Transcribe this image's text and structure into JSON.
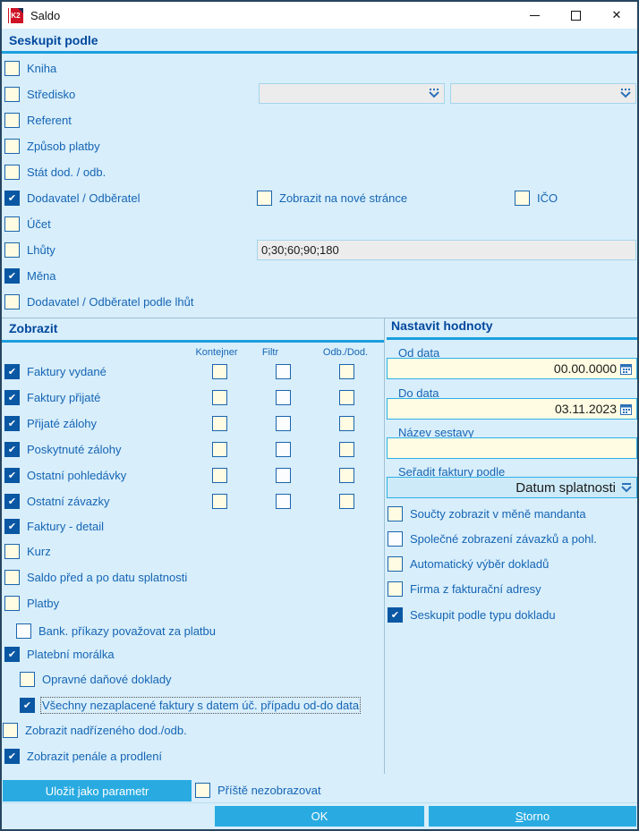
{
  "window": {
    "title": "Saldo"
  },
  "group_by": {
    "title": "Seskupit podle",
    "items": [
      {
        "label": "Kniha",
        "checked": false
      },
      {
        "label": "Středisko",
        "checked": false
      },
      {
        "label": "Referent",
        "checked": false
      },
      {
        "label": "Způsob platby",
        "checked": false
      },
      {
        "label": "Stát dod. / odb.",
        "checked": false
      },
      {
        "label": "Dodavatel / Odběratel",
        "checked": true
      },
      {
        "label": "Účet",
        "checked": false
      },
      {
        "label": "Lhůty",
        "checked": false
      },
      {
        "label": "Měna",
        "checked": true
      },
      {
        "label": "Dodavatel / Odběratel podle lhůt",
        "checked": false
      }
    ],
    "new_page": {
      "label": "Zobrazit na nové stránce",
      "checked": false
    },
    "ico": {
      "label": "IČO",
      "checked": false
    },
    "lhuty_value": "0;30;60;90;180",
    "combo1_value": "",
    "combo2_value": ""
  },
  "show": {
    "title": "Zobrazit",
    "columns": [
      "Kontejner",
      "Filtr",
      "Odb./Dod."
    ],
    "rows": [
      {
        "label": "Faktury vydané",
        "checked": true,
        "kontejner": false,
        "filtr": false,
        "odb_dod": false
      },
      {
        "label": "Faktury přijaté",
        "checked": true,
        "kontejner": false,
        "filtr": false,
        "odb_dod": false
      },
      {
        "label": "Přijaté zálohy",
        "checked": true,
        "kontejner": false,
        "filtr": false,
        "odb_dod": false
      },
      {
        "label": "Poskytnuté zálohy",
        "checked": true,
        "kontejner": false,
        "filtr": false,
        "odb_dod": false
      },
      {
        "label": "Ostatní pohledávky",
        "checked": true,
        "kontejner": false,
        "filtr": false,
        "odb_dod": false
      },
      {
        "label": "Ostatní závazky",
        "checked": true,
        "kontejner": false,
        "filtr": false,
        "odb_dod": false
      }
    ],
    "extra_rows": [
      {
        "label": "Faktury - detail",
        "checked": true
      },
      {
        "label": "Kurz",
        "checked": false
      },
      {
        "label": "Saldo před a po datu splatnosti",
        "checked": false
      },
      {
        "label": "Platby",
        "checked": false
      },
      {
        "label": "Bank. příkazy považovat za platbu",
        "checked": false
      },
      {
        "label": "Platební morálka",
        "checked": true
      },
      {
        "label": "Opravné daňové doklady",
        "checked": false
      },
      {
        "label": "Všechny nezaplacené faktury s datem úč. případu od-do data",
        "checked": true
      },
      {
        "label": "Zobrazit nadřízeného dod./odb.",
        "checked": false
      },
      {
        "label": "Zobrazit penále a prodlení",
        "checked": true
      }
    ]
  },
  "set_values": {
    "title": "Nastavit hodnoty",
    "from_date": {
      "label": "Od data",
      "value": "00.00.0000"
    },
    "to_date": {
      "label": "Do data",
      "value": "03.11.2023"
    },
    "report_name": {
      "label": "Název sestavy",
      "value": ""
    },
    "sort_by": {
      "label": "Seřadit faktury podle",
      "value": "Datum splatnosti"
    },
    "options": [
      {
        "label": "Součty zobrazit v měně mandanta",
        "checked": false
      },
      {
        "label": "Společné zobrazení závazků a pohl.",
        "checked": false
      },
      {
        "label": "Automatický výběr dokladů",
        "checked": false
      },
      {
        "label": "Firma z fakturační adresy",
        "checked": false
      },
      {
        "label": "Seskupit podle typu dokladu",
        "checked": true
      }
    ]
  },
  "footer": {
    "save_param_label": "Uložit jako parametr",
    "dont_show": {
      "label": "Příště nezobrazovat",
      "checked": false
    },
    "ok_label": "OK",
    "storno_key": "S",
    "storno_rest": "torno"
  },
  "colors": {
    "background": "#d8eefb",
    "section_header": "#00489e",
    "section_rule": "#1b9fdd",
    "label_blue": "#1565b4",
    "checkbox_border": "#1b65ad",
    "checkbox_checked": "#0a57a3",
    "checkbox_cream": "#fffce3",
    "button_blue": "#29abe2",
    "field_border_cyan": "#2eb0e6",
    "field_gray": "#ececec"
  }
}
